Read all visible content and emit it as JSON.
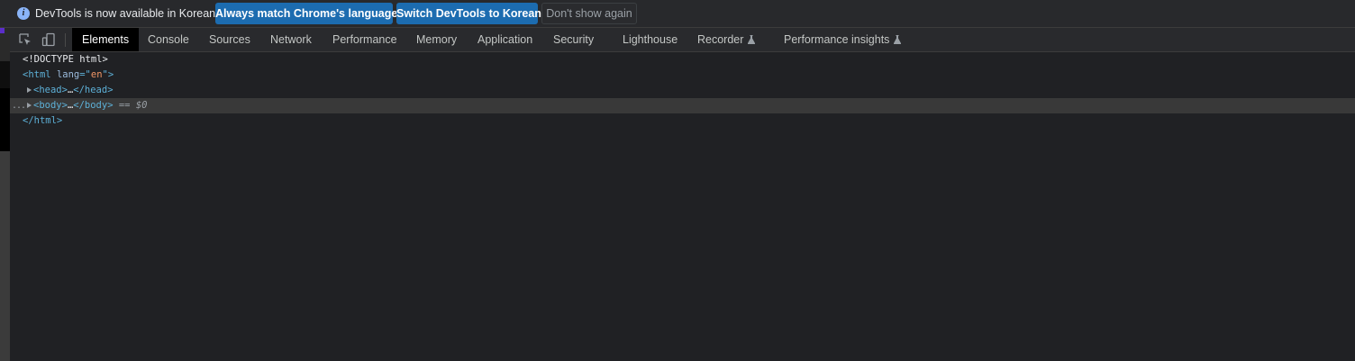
{
  "infobar": {
    "message": "DevTools is now available in Korean!",
    "buttons": {
      "always_match": "Always match Chrome's language",
      "switch": "Switch DevTools to Korean",
      "dismiss": "Don't show again"
    }
  },
  "toolbar": {
    "tabs": [
      {
        "label": "Elements",
        "active": true
      },
      {
        "label": "Console"
      },
      {
        "label": "Sources"
      },
      {
        "label": "Network"
      },
      {
        "label": "Performance"
      },
      {
        "label": "Memory"
      },
      {
        "label": "Application"
      },
      {
        "label": "Security"
      },
      {
        "label": "Lighthouse"
      },
      {
        "label": "Recorder",
        "experimental": true
      },
      {
        "label": "Performance insights",
        "experimental": true
      }
    ]
  },
  "dom_tree": {
    "doctype": "<!DOCTYPE html>",
    "html_open": "<html",
    "html_attr_name": "lang",
    "html_attr_eq": "=\"",
    "html_attr_value": "en",
    "html_attr_close": "\">",
    "head_open": "<head>",
    "head_ellipsis": "…",
    "head_close": "</head>",
    "body_dots": "...",
    "body_open": "<body>",
    "body_ellipsis": "…",
    "body_close": "</body>",
    "body_marker": "== $0",
    "html_close": "</html>"
  }
}
